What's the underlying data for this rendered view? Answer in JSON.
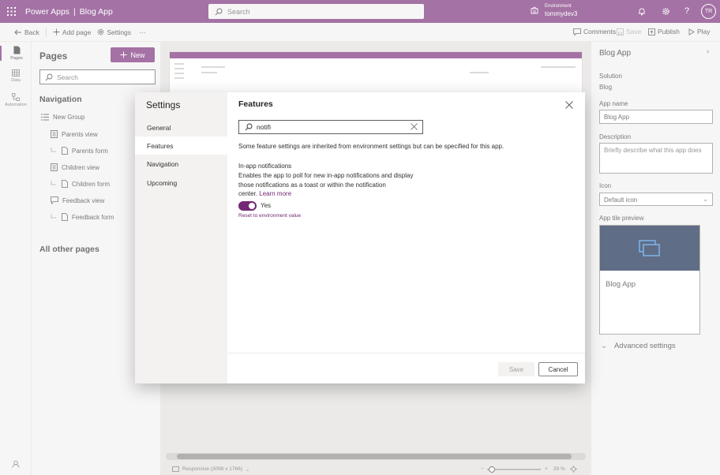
{
  "topbar": {
    "app_name": "Power Apps",
    "separator": "|",
    "app_title": "Blog App",
    "search_placeholder": "Search",
    "environment_label": "Environment",
    "environment_name": "tommydev3",
    "avatar_initials": "TR",
    "accent_color": "#742774"
  },
  "commandbar": {
    "back": "Back",
    "add_page": "Add page",
    "settings": "Settings",
    "more": "···",
    "comments": "Comments",
    "save": "Save",
    "publish": "Publish",
    "play": "Play"
  },
  "rail": {
    "pages": "Pages",
    "data": "Data",
    "automation": "Automation"
  },
  "pages_panel": {
    "title": "Pages",
    "new_button": "New",
    "search_placeholder": "Search",
    "navigation_heading": "Navigation",
    "items": [
      {
        "label": "New Group",
        "icon": "group-icon"
      },
      {
        "label": "Parents view",
        "icon": "view-icon"
      },
      {
        "label": "Parents form",
        "icon": "form-icon"
      },
      {
        "label": "Children view",
        "icon": "view-icon"
      },
      {
        "label": "Children form",
        "icon": "form-icon"
      },
      {
        "label": "Feedback view",
        "icon": "feedback-view-icon"
      },
      {
        "label": "Feedback form",
        "icon": "form-icon"
      }
    ],
    "other_pages_heading": "All other pages"
  },
  "canvas": {
    "responsive_label": "Responsive (3098 x 1766)",
    "zoom_minus": "−",
    "zoom_plus": "+",
    "zoom_level": "29 %"
  },
  "properties": {
    "title": "Blog App",
    "solution_label": "Solution",
    "solution_value": "Blog",
    "app_name_label": "App name",
    "app_name_value": "Blog App",
    "description_label": "Description",
    "description_placeholder": "Briefly describe what this app does",
    "icon_label": "Icon",
    "icon_value": "Default icon",
    "tile_preview_label": "App tile preview",
    "tile_name": "Blog App",
    "tile_color": "#0b1f46",
    "advanced_settings": "Advanced settings"
  },
  "dialog": {
    "nav_title": "Settings",
    "nav_items": [
      "General",
      "Features",
      "Navigation",
      "Upcoming"
    ],
    "selected_nav": "Features",
    "body_title": "Features",
    "search_value": "notifi",
    "info_text": "Some feature settings are inherited from environment settings but can be specified for this app.",
    "feature_title": "In-app notifications",
    "feature_desc_line1": "Enables the app to poll for new in-app notifications and display",
    "feature_desc_line2": "those notifications as a toast or within the notification",
    "feature_desc_line3": "center.",
    "learn_more": "Learn more",
    "toggle_state": "Yes",
    "reset_link": "Reset to environment value",
    "save_button": "Save",
    "cancel_button": "Cancel"
  }
}
